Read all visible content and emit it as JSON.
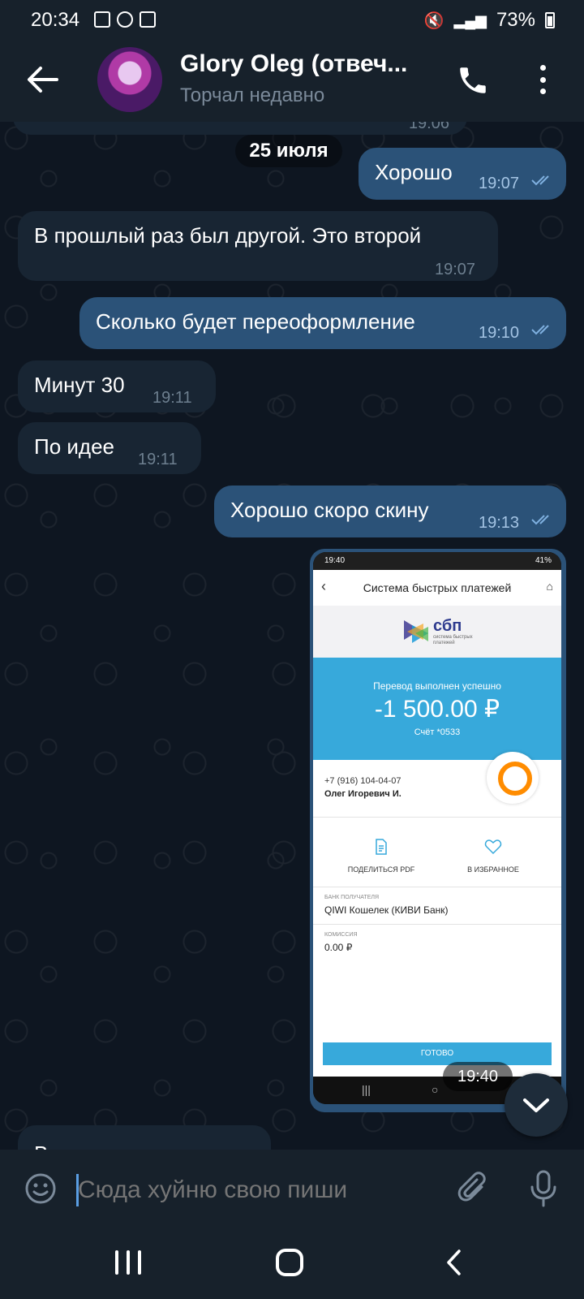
{
  "status_bar": {
    "time": "20:34",
    "battery": "73%"
  },
  "header": {
    "title": "Glory Oleg (отвеч...",
    "subtitle": "Торчал недавно"
  },
  "chat": {
    "partial_prev_time": "19:06",
    "date_separator": "25 июля",
    "messages": [
      {
        "direction": "out",
        "text": "Хорошо",
        "time": "19:07",
        "status": "read"
      },
      {
        "direction": "in",
        "text": "В прошлый раз был другой. Это второй",
        "time": "19:07"
      },
      {
        "direction": "out",
        "text": "Сколько будет переоформление",
        "time": "19:10",
        "status": "read"
      },
      {
        "direction": "in",
        "text": "Минут 30",
        "time": "19:11"
      },
      {
        "direction": "in",
        "text": "По идее",
        "time": "19:11"
      },
      {
        "direction": "out",
        "text": "Хорошо скоро скину",
        "time": "19:13",
        "status": "read"
      }
    ],
    "image_message": {
      "time": "19:40",
      "screenshot": {
        "status_time": "19:40",
        "status_battery": "41%",
        "title": "Система быстрых платежей",
        "logo_text": "сбп",
        "logo_caption": "система быстрых платежей",
        "success_text": "Перевод выполнен успешно",
        "amount": "-1 500.00 ₽",
        "account": "Счёт *0533",
        "phone": "+7 (916) 104-04-07",
        "recipient": "Олег Игоревич И.",
        "share_label": "ПОДЕЛИТЬСЯ PDF",
        "favorite_label": "В ИЗБРАННОЕ",
        "bank_label": "БАНК ПОЛУЧАТЕЛЯ",
        "bank_value": "QIWI Кошелек (КИВИ Банк)",
        "fee_label": "КОМИССИЯ",
        "fee_value": "0.00 ₽",
        "done_label": "ГОТОВО"
      }
    },
    "partial_next_text": "Вижу отлично"
  },
  "composer": {
    "placeholder": "Сюда хуйню свою пиши"
  },
  "colors": {
    "background": "#0e1621",
    "header": "#17212b",
    "incoming_bubble": "#182533",
    "outgoing_bubble": "#2b5278",
    "accent": "#5a9ee3"
  }
}
